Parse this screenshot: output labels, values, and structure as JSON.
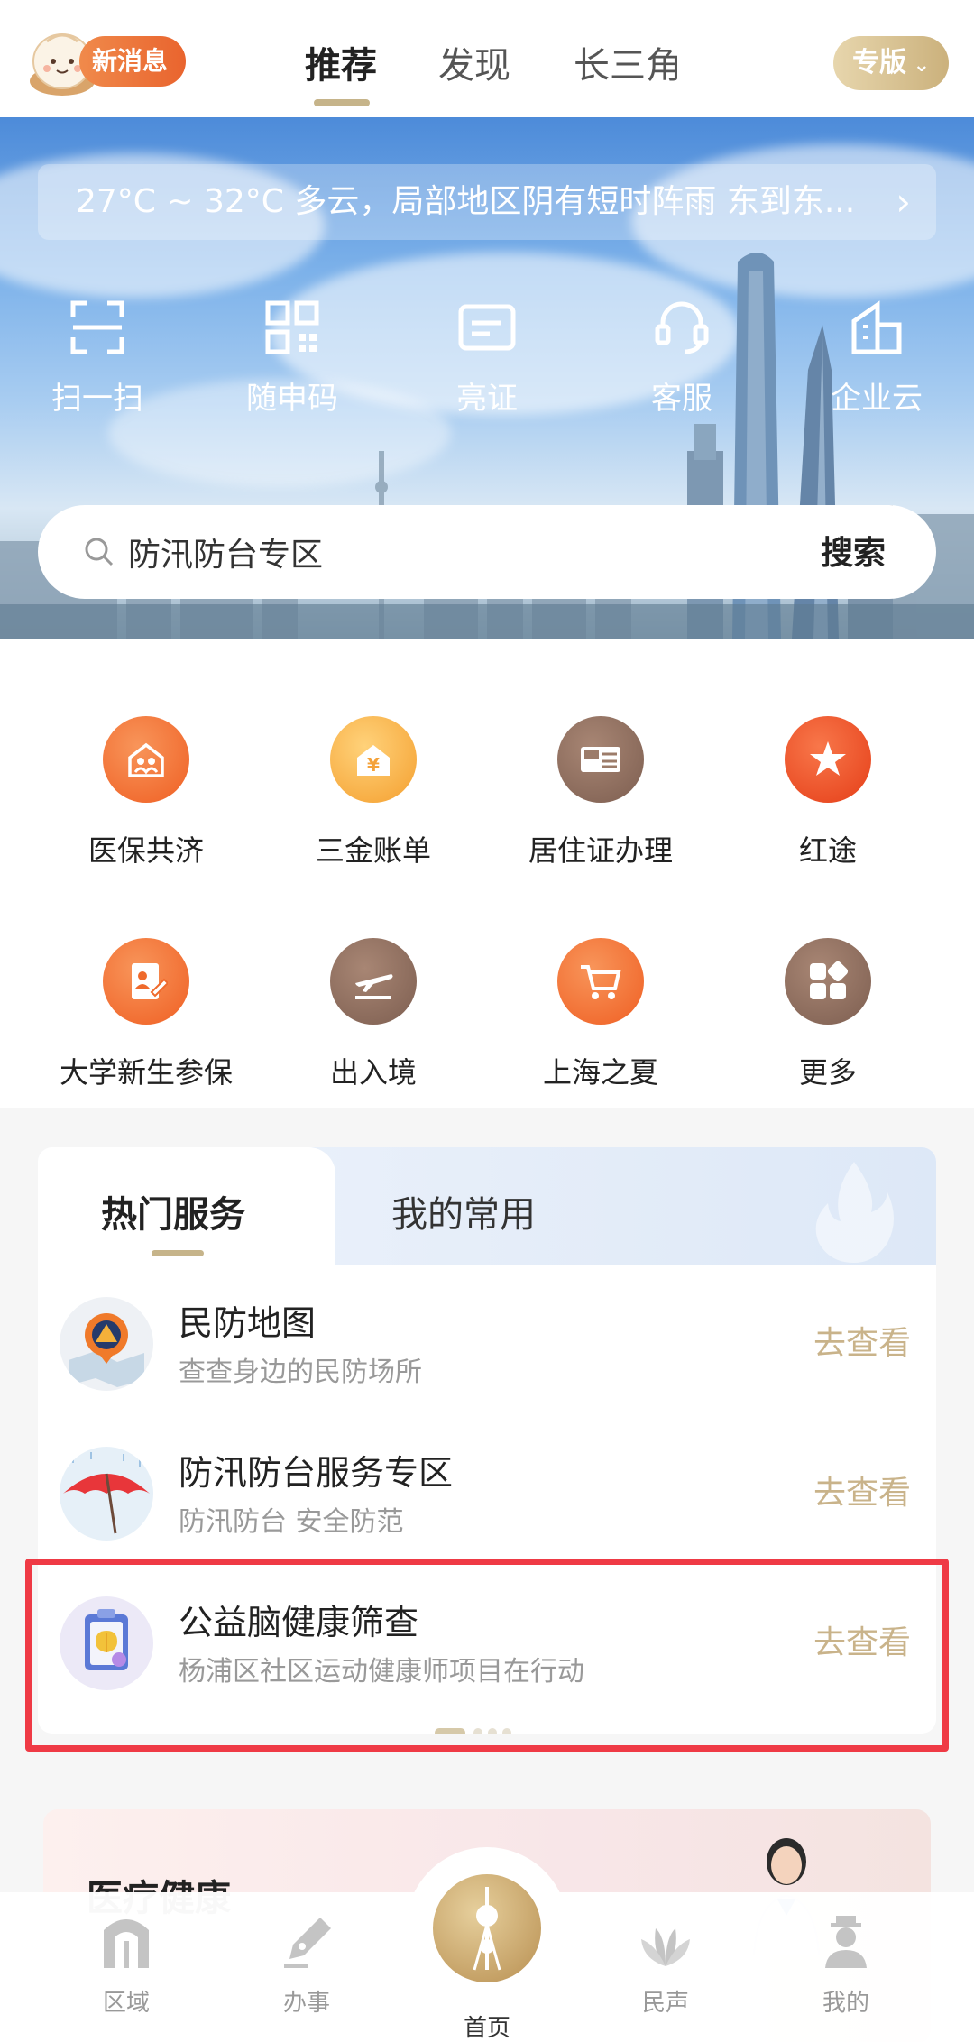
{
  "header": {
    "message_badge": "新消息",
    "tabs": [
      {
        "label": "推荐",
        "active": true
      },
      {
        "label": "发现",
        "active": false
      },
      {
        "label": "长三角",
        "active": false
      }
    ],
    "edition_button": "专版"
  },
  "hero": {
    "weather": "27°C ~ 32°C  多云，局部地区阴有短时阵雨  东到东...",
    "quick_actions": [
      {
        "label": "扫一扫",
        "icon": "scan-icon"
      },
      {
        "label": "随申码",
        "icon": "qr-code-icon"
      },
      {
        "label": "亮证",
        "icon": "id-card-icon"
      },
      {
        "label": "客服",
        "icon": "headset-icon"
      },
      {
        "label": "企业云",
        "icon": "building-icon"
      }
    ],
    "search": {
      "placeholder": "防汛防台专区",
      "button": "搜索"
    }
  },
  "services": [
    {
      "label": "医保共济",
      "icon": "family-house-icon",
      "color": "#f06b2a"
    },
    {
      "label": "三金账单",
      "icon": "yen-house-icon",
      "color": "#f7a53a"
    },
    {
      "label": "居住证办理",
      "icon": "residence-card-icon",
      "color": "#8c6a5a"
    },
    {
      "label": "红途",
      "icon": "star-flag-icon",
      "color": "#ee4a22"
    },
    {
      "label": "大学新生参保",
      "icon": "student-form-icon",
      "color": "#f0692c"
    },
    {
      "label": "出入境",
      "icon": "plane-icon",
      "color": "#8f6f5f"
    },
    {
      "label": "上海之夏",
      "icon": "shopping-cart-icon",
      "color": "#f16a2b"
    },
    {
      "label": "更多",
      "icon": "more-grid-icon",
      "color": "#8c6a5a"
    }
  ],
  "hot_services": {
    "tabs": [
      {
        "label": "热门服务",
        "active": true
      },
      {
        "label": "我的常用",
        "active": false
      }
    ],
    "items": [
      {
        "title": "民防地图",
        "subtitle": "查查身边的民防场所",
        "link": "去查看",
        "icon": "civil-defense-map-icon"
      },
      {
        "title": "防汛防台服务专区",
        "subtitle": "防汛防台 安全防范",
        "link": "去查看",
        "icon": "umbrella-icon"
      },
      {
        "title": "公益脑健康筛查",
        "subtitle": "杨浦区社区运动健康师项目在行动",
        "link": "去查看",
        "icon": "brain-clipboard-icon"
      }
    ]
  },
  "next_section": {
    "title": "医疗健康"
  },
  "bottom_nav": [
    {
      "label": "区域",
      "icon": "region-gate-icon"
    },
    {
      "label": "办事",
      "icon": "pen-nib-icon"
    },
    {
      "label": "首页",
      "icon": "pearl-tower-icon",
      "active": true
    },
    {
      "label": "民声",
      "icon": "magnolia-icon"
    },
    {
      "label": "我的",
      "icon": "profile-icon"
    }
  ],
  "colors": {
    "accent_gold": "#c6b48a",
    "highlight_red": "#ef3a45"
  }
}
